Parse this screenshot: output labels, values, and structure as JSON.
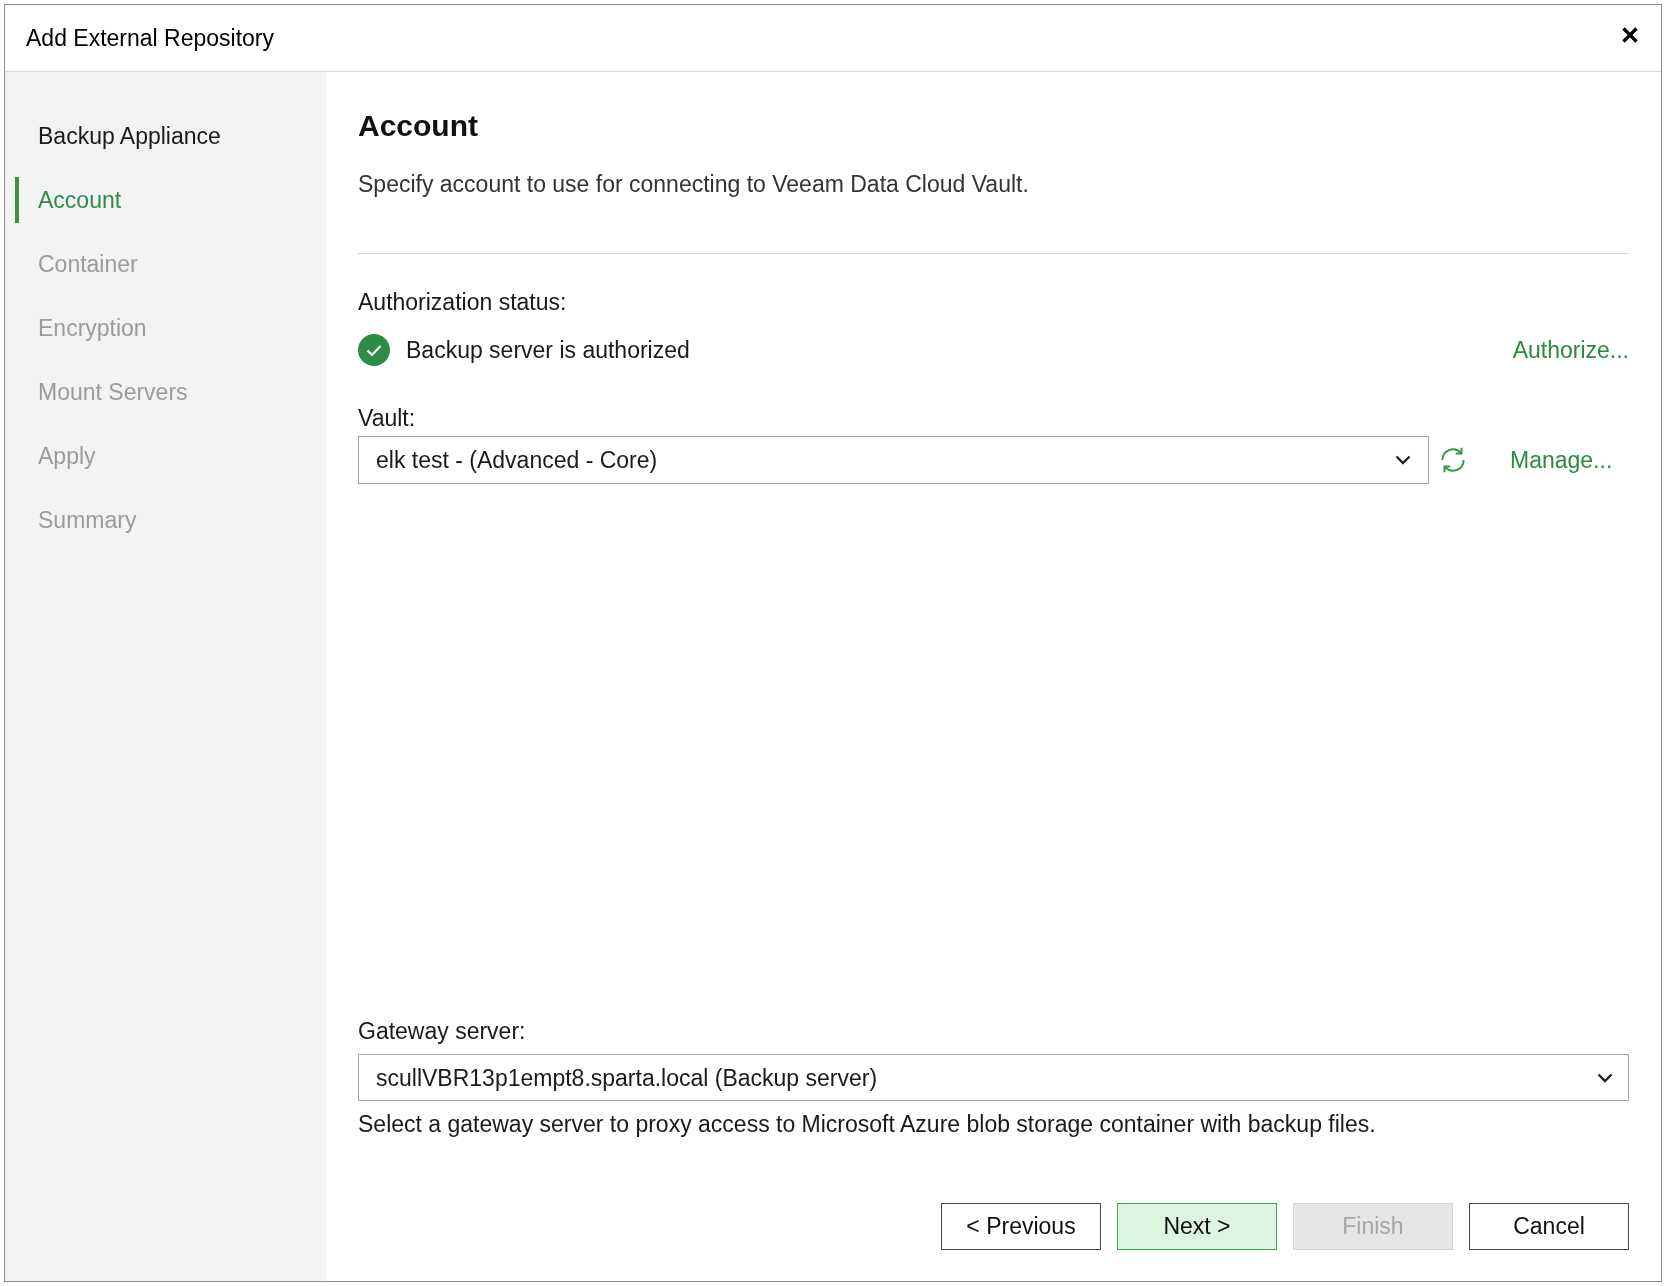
{
  "window": {
    "title": "Add External Repository"
  },
  "sidebar": {
    "items": [
      {
        "label": "Backup Appliance",
        "selected": false,
        "disabled": false
      },
      {
        "label": "Account",
        "selected": true,
        "disabled": false
      },
      {
        "label": "Container",
        "selected": false,
        "disabled": true
      },
      {
        "label": "Encryption",
        "selected": false,
        "disabled": true
      },
      {
        "label": "Mount Servers",
        "selected": false,
        "disabled": true
      },
      {
        "label": "Apply",
        "selected": false,
        "disabled": true
      },
      {
        "label": "Summary",
        "selected": false,
        "disabled": true
      }
    ]
  },
  "page": {
    "title": "Account",
    "description": "Specify account to use for connecting to Veeam Data Cloud Vault."
  },
  "authorization": {
    "label": "Authorization status:",
    "authorized": true,
    "status": "Backup server is authorized",
    "link": "Authorize..."
  },
  "vault": {
    "label": "Vault:",
    "value": "elk test - (Advanced - Core)",
    "link": "Manage..."
  },
  "gateway": {
    "label": "Gateway server:",
    "value": "scullVBR13p1empt8.sparta.local (Backup server)",
    "hint": "Select a gateway server to proxy access to Microsoft Azure blob storage container with backup files."
  },
  "buttons": [
    {
      "label": "< Previous",
      "primary": false,
      "disabled": false
    },
    {
      "label": "Next >",
      "primary": true,
      "disabled": false
    },
    {
      "label": "Finish",
      "primary": false,
      "disabled": true
    },
    {
      "label": "Cancel",
      "primary": false,
      "disabled": false
    }
  ]
}
